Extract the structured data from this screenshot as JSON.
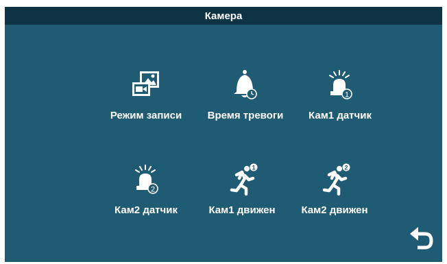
{
  "header": {
    "title": "Камера"
  },
  "menu": {
    "items": [
      {
        "label": "Режим записи",
        "icon": "record-mode-icon"
      },
      {
        "label": "Время тревоги",
        "icon": "alarm-time-icon"
      },
      {
        "label": "Кам1 датчик",
        "icon": "cam1-sensor-icon",
        "badge": "1"
      },
      {
        "label": "Кам2 датчик",
        "icon": "cam2-sensor-icon",
        "badge": "2"
      },
      {
        "label": "Кам1 движен",
        "icon": "cam1-motion-icon",
        "badge": "1"
      },
      {
        "label": "Кам2 движен",
        "icon": "cam2-motion-icon",
        "badge": "2"
      }
    ]
  },
  "controls": {
    "back": "back-arrow-icon"
  },
  "colors": {
    "background": "#1f5b72",
    "titlebar": "#0e3344",
    "foreground": "#ffffff"
  }
}
